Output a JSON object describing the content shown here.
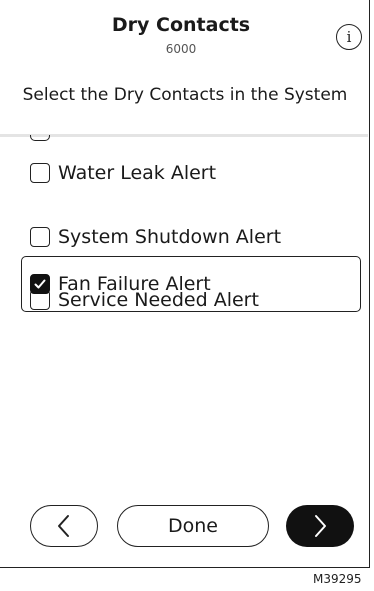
{
  "header": {
    "title": "Dry Contacts",
    "subtitle": "6000",
    "info_icon": "info-icon",
    "info_glyph": "i"
  },
  "instruction": "Select the Dry Contacts in the System",
  "list": {
    "items": [
      {
        "label": "Water Leak Alert",
        "checked": false
      },
      {
        "label": "System Shutdown Alert",
        "checked": false
      },
      {
        "label": "Service Needed Alert",
        "checked": false
      },
      {
        "label": "Fan Failure Alert",
        "checked": true
      }
    ]
  },
  "footer": {
    "back_icon": "chevron-left-icon",
    "done_label": "Done",
    "next_icon": "chevron-right-icon"
  },
  "figure_id": "M39295",
  "colors": {
    "text": "#1a1a1a",
    "border": "#222222",
    "primary_button": "#111111",
    "divider": "#e4e4e4"
  }
}
